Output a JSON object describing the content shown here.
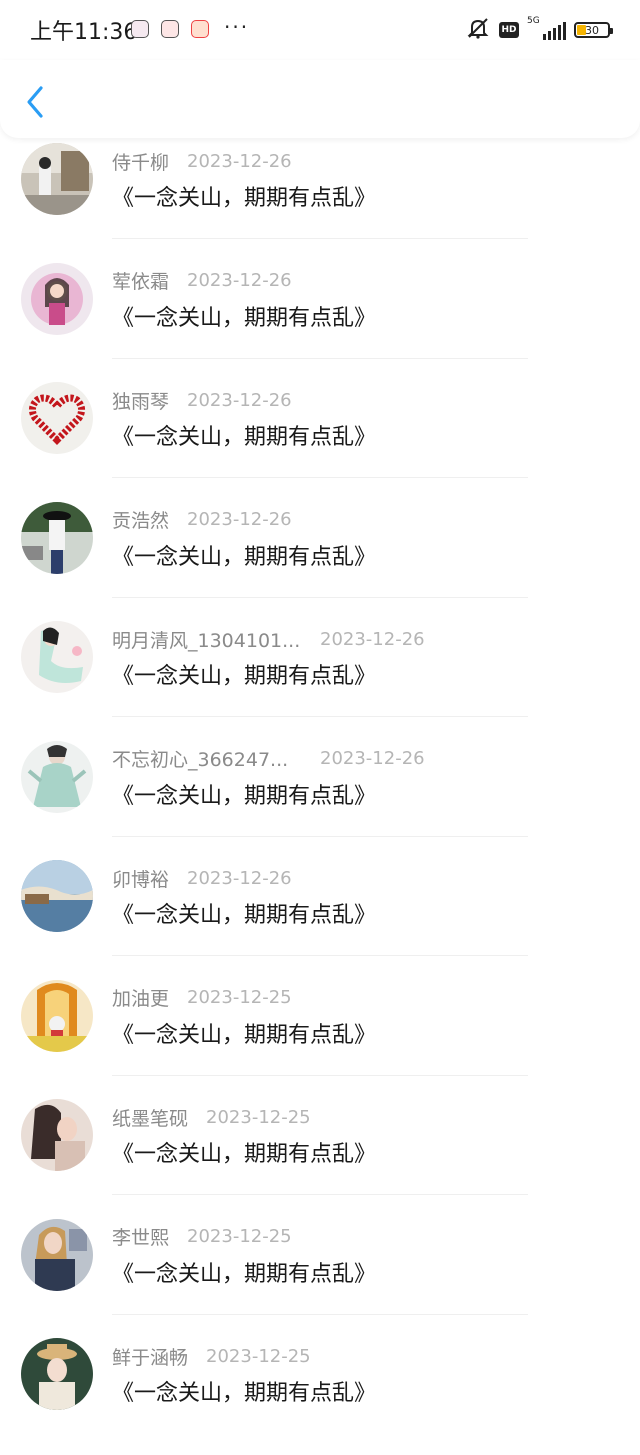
{
  "status_bar": {
    "time": "上午11:36",
    "more": "···",
    "network": "5G",
    "hd": "HD",
    "battery": "30",
    "battery_level": 0.3
  },
  "nav": {
    "back_icon": "chevron-left-icon",
    "accent": "#2a9df4"
  },
  "comments": [
    {
      "user": "侍千柳",
      "date": "2023-12-26",
      "text": "《一念关山，期期有点乱》"
    },
    {
      "user": "荤依霜",
      "date": "2023-12-26",
      "text": "《一念关山，期期有点乱》"
    },
    {
      "user": "独雨琴",
      "date": "2023-12-26",
      "text": "《一念关山，期期有点乱》"
    },
    {
      "user": "贡浩然",
      "date": "2023-12-26",
      "text": "《一念关山，期期有点乱》"
    },
    {
      "user": "明月清风_1304101...",
      "date": "2023-12-26",
      "text": "《一念关山，期期有点乱》"
    },
    {
      "user": "不忘初心_366247...",
      "date": "2023-12-26",
      "text": "《一念关山，期期有点乱》"
    },
    {
      "user": "卯博裕",
      "date": "2023-12-26",
      "text": "《一念关山，期期有点乱》"
    },
    {
      "user": "加油更",
      "date": "2023-12-25",
      "text": "《一念关山，期期有点乱》"
    },
    {
      "user": "纸墨笔砚",
      "date": "2023-12-25",
      "text": "《一念关山，期期有点乱》"
    },
    {
      "user": "李世熙",
      "date": "2023-12-25",
      "text": "《一念关山，期期有点乱》"
    },
    {
      "user": "鲜于涵畅",
      "date": "2023-12-25",
      "text": "《一念关山，期期有点乱》"
    }
  ]
}
